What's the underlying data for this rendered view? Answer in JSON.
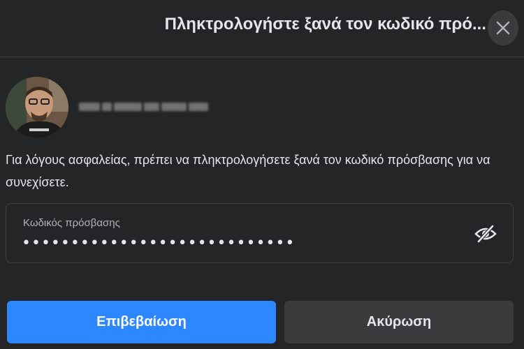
{
  "dialog": {
    "title": "Πληκτρολογήστε ξανά τον κωδικό πρό...",
    "close_icon": "close-icon"
  },
  "user": {
    "avatar_icon": "profile-photo",
    "name_redacted": true
  },
  "message": "Για λόγους ασφαλείας, πρέπει να πληκτρολογήσετε ξανά τον κωδικό πρόσβασης για να συνεχίσετε.",
  "password": {
    "label": "Κωδικός πρόσβασης",
    "value": "••••••••••••••••••••••••••••",
    "toggle_icon": "eye-slash-icon"
  },
  "buttons": {
    "confirm_label": "Επιβεβαίωση",
    "cancel_label": "Ακύρωση"
  },
  "colors": {
    "background": "#242526",
    "primary": "#2d88ff",
    "secondary_button": "#3a3b3c",
    "text": "#e4e6eb",
    "muted_text": "#b0b3b8"
  }
}
